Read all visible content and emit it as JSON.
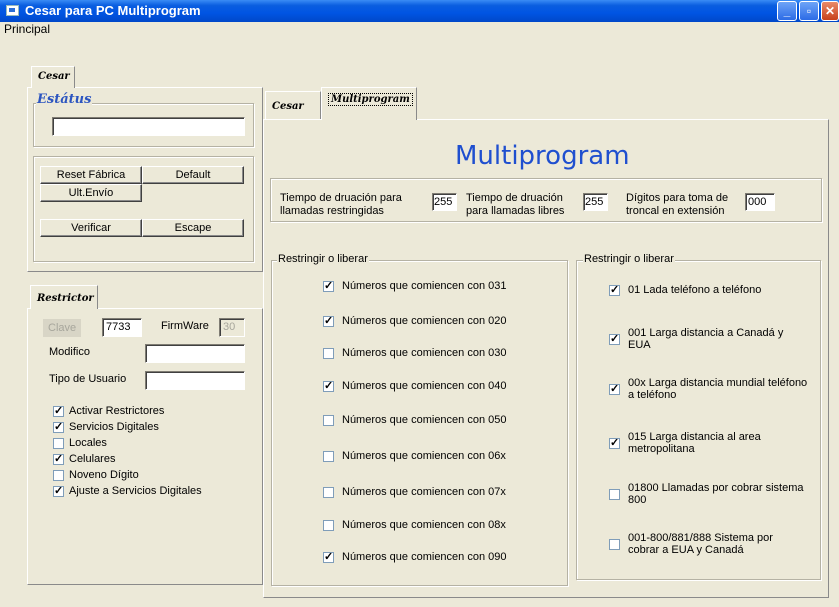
{
  "window": {
    "title": "Cesar para PC Multiprogram"
  },
  "menu": {
    "items": [
      "Principal"
    ]
  },
  "left_top": {
    "tab": "Cesar",
    "status_title": "Estátus",
    "status_value": "",
    "buttons": {
      "reset": "Reset Fábrica",
      "default": "Default",
      "ult": "Ult.Envío",
      "verificar": "Verificar",
      "escape": "Escape"
    }
  },
  "restrictor": {
    "tab": "Restrictor",
    "clave_label": "Clave",
    "clave_value": "7733",
    "firmware_label": "FirmWare",
    "firmware_value": "30",
    "modifico_label": "Modifico",
    "modifico_value": "",
    "tipo_label": "Tipo de Usuario",
    "tipo_value": "",
    "checks": [
      {
        "label": "Activar Restrictores",
        "checked": true
      },
      {
        "label": "Servicios Digitales",
        "checked": true
      },
      {
        "label": "Locales",
        "checked": false
      },
      {
        "label": "Celulares",
        "checked": true
      },
      {
        "label": "Noveno Dígito",
        "checked": false
      },
      {
        "label": "Ajuste a Servicios Digitales",
        "checked": true
      }
    ]
  },
  "right": {
    "tabs": [
      "Cesar",
      "Multiprogram"
    ],
    "heading": "Multiprogram",
    "time_fields": [
      {
        "label_1": "Tiempo de druación para",
        "label_2": "llamadas restringidas",
        "value": "255"
      },
      {
        "label_1": "Tiempo de druación",
        "label_2": "para llamadas libres",
        "value": "255"
      },
      {
        "label_1": "Dígitos para toma de",
        "label_2": "troncal en extensión",
        "value": "000"
      }
    ],
    "frame_left": {
      "title": "Restringir o liberar",
      "items": [
        {
          "label": "Números que comiencen con 031",
          "checked": true
        },
        {
          "label": "Números que comiencen con 020",
          "checked": true
        },
        {
          "label": "Números que comiencen con 030",
          "checked": false
        },
        {
          "label": "Números que comiencen con 040",
          "checked": true
        },
        {
          "label": "Números que comiencen con 050",
          "checked": false
        },
        {
          "label": "Números que comiencen con 06x",
          "checked": false
        },
        {
          "label": "Números que comiencen con 07x",
          "checked": false
        },
        {
          "label": "Números que comiencen con 08x",
          "checked": false
        },
        {
          "label": "Números que comiencen con 090",
          "checked": true
        }
      ]
    },
    "frame_right": {
      "title": "Restringir o liberar",
      "items": [
        {
          "line1": "01 Lada teléfono a teléfono",
          "line2": "",
          "checked": true
        },
        {
          "line1": "001 Larga distancia a Canadá y",
          "line2": "EUA",
          "checked": true
        },
        {
          "line1": "00x Larga distancia mundial teléfono",
          "line2": "a teléfono",
          "checked": true
        },
        {
          "line1": "015 Larga distancia al area",
          "line2": "metropolitana",
          "checked": true
        },
        {
          "line1": "01800 Llamadas por cobrar sistema",
          "line2": "800",
          "checked": false
        },
        {
          "line1": "001-800/881/888 Sistema por",
          "line2": "cobrar a EUA y Canadá",
          "checked": false
        }
      ]
    }
  }
}
